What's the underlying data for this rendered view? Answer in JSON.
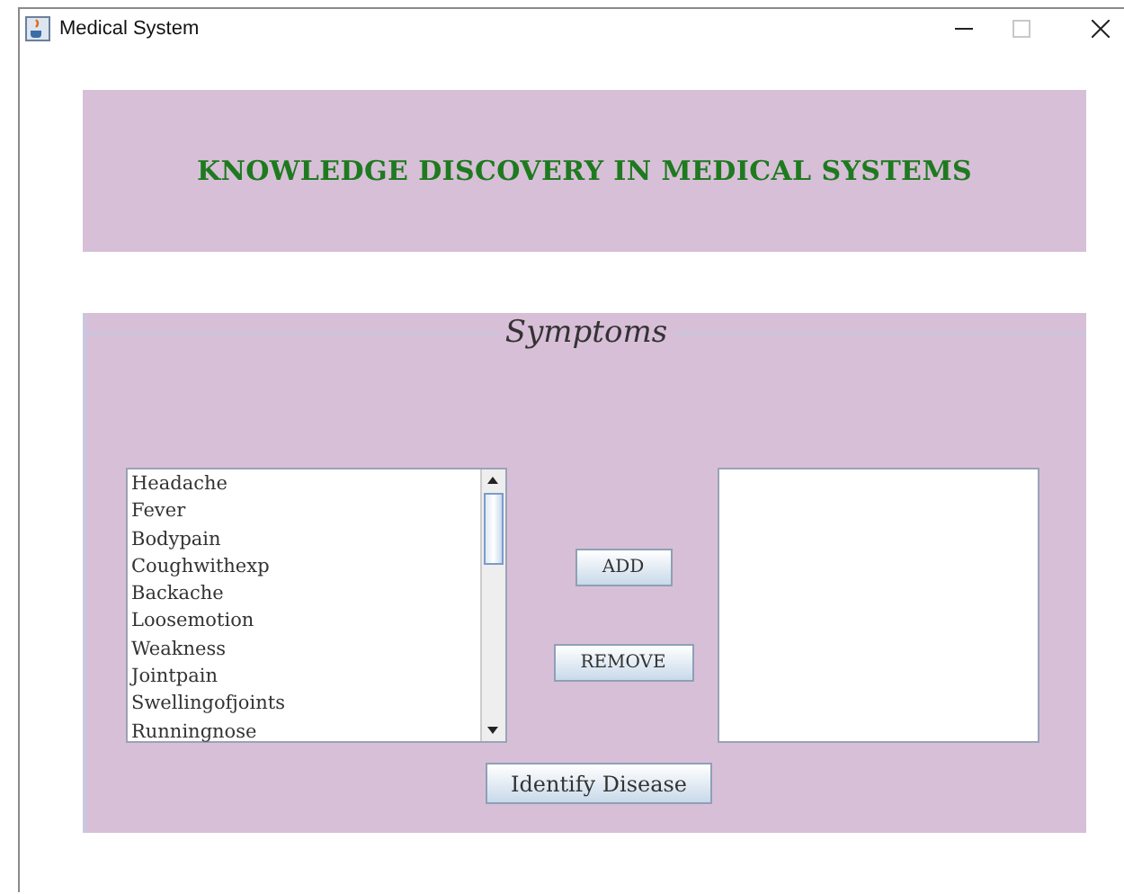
{
  "window": {
    "title": "Medical System"
  },
  "header": {
    "title": "KNOWLEDGE DISCOVERY IN MEDICAL SYSTEMS"
  },
  "symptoms_panel": {
    "title": "Symptoms",
    "available": [
      "Headache",
      "Fever",
      "Bodypain",
      "Coughwithexp",
      "Backache",
      "Loosemotion",
      "Weakness",
      "Jointpain",
      "Swellingofjoints",
      "Runningnose"
    ],
    "buttons": [
      "ADD",
      "REMOVE"
    ],
    "action": "Identify Disease"
  }
}
